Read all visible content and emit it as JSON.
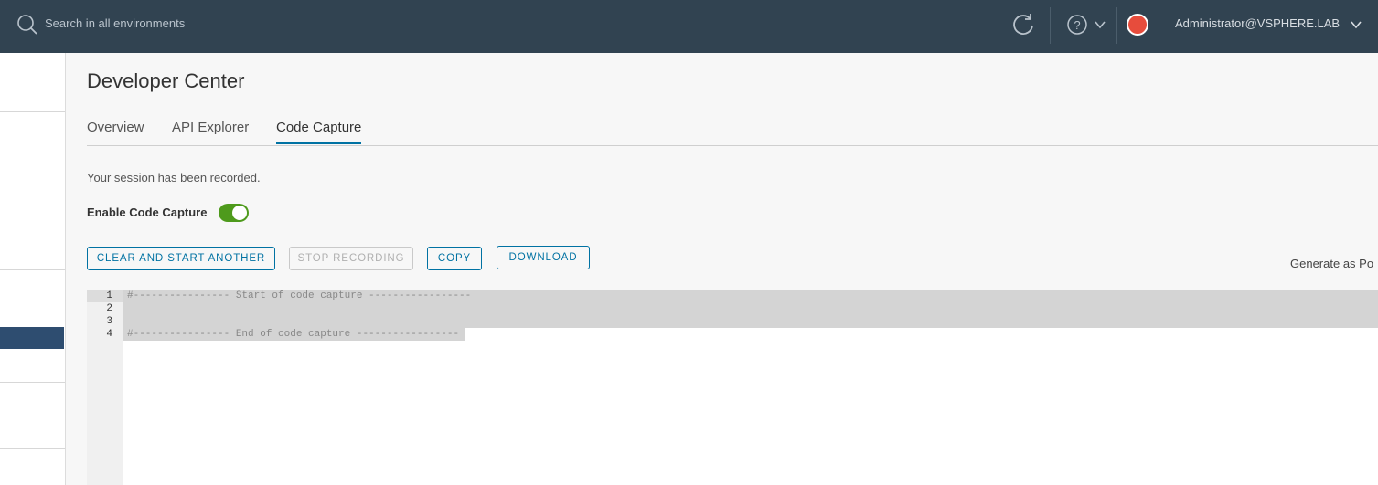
{
  "header": {
    "search_placeholder": "Search in all environments",
    "user": "Administrator@VSPHERE.LAB",
    "icons": [
      "search-icon",
      "refresh-icon",
      "help-icon",
      "chevron-down-icon",
      "record-indicator-icon"
    ],
    "colors": {
      "background": "#314351",
      "record": "#e74c3c"
    }
  },
  "page": {
    "title": "Developer Center",
    "tabs": [
      {
        "label": "Overview",
        "active": false
      },
      {
        "label": "API Explorer",
        "active": false
      },
      {
        "label": "Code Capture",
        "active": true
      }
    ]
  },
  "code_capture": {
    "session_message": "Your session has been recorded.",
    "toggle_label": "Enable Code Capture",
    "toggle_on": true,
    "buttons": {
      "clear": "CLEAR AND START ANOTHER",
      "stop": "STOP RECORDING",
      "copy": "COPY",
      "download": "DOWNLOAD"
    },
    "generate_as_label": "Generate as Po",
    "editor": {
      "line_numbers": [
        "1",
        "2",
        "3",
        "4"
      ],
      "lines": [
        "#---------------- Start of code capture -----------------",
        "",
        "",
        "#---------------- End of code capture -----------------"
      ]
    }
  },
  "colors": {
    "accent": "#0072a3",
    "toggle_on": "#4e9a1c",
    "sidebar_selected": "#2e4d70"
  }
}
